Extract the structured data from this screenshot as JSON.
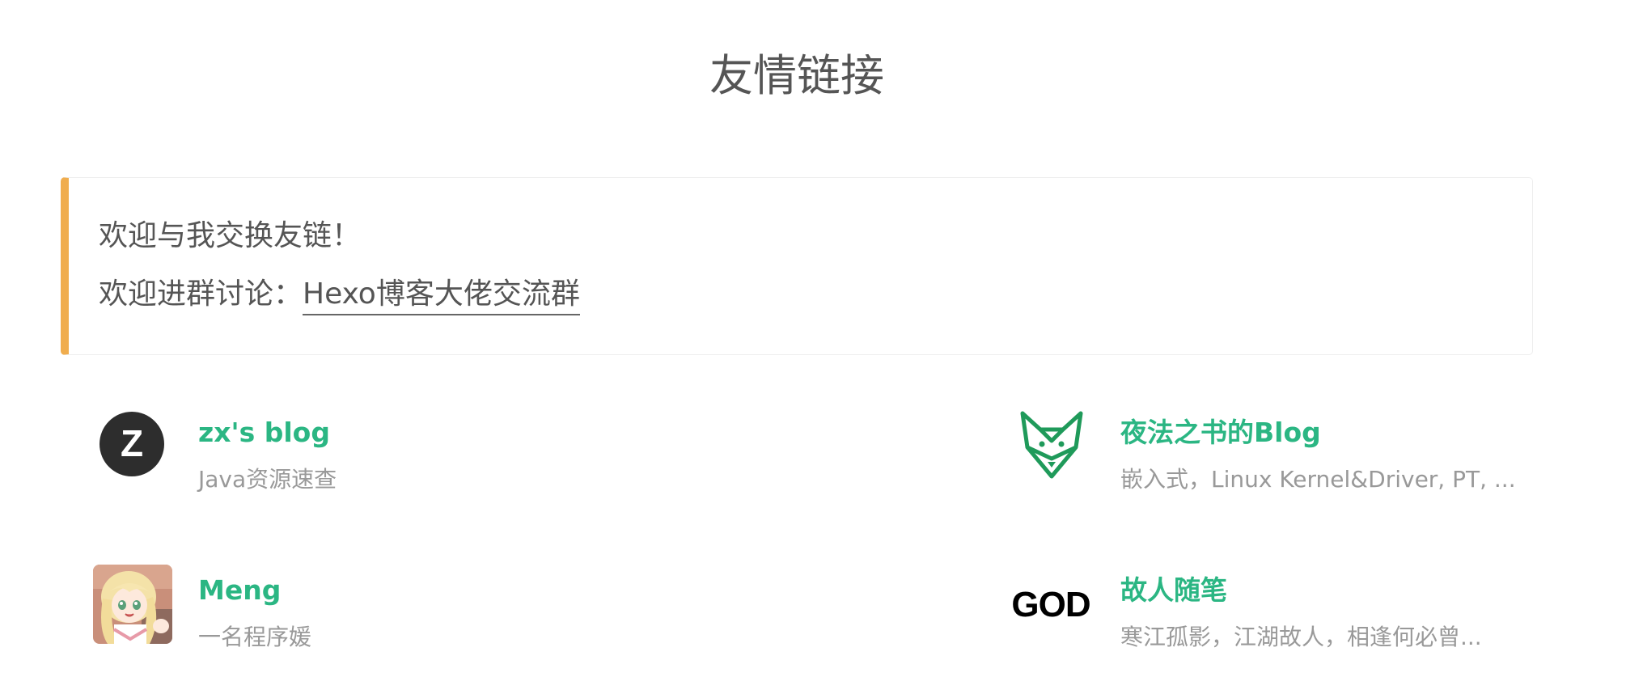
{
  "page": {
    "title": "友情链接"
  },
  "note": {
    "line1": "欢迎与我交换友链！",
    "line2_prefix": "欢迎进群讨论：",
    "line2_link": "Hexo博客大佬交流群",
    "accent_color": "#f0ad4e"
  },
  "friends": [
    {
      "name": "zx's blog",
      "description": "Java资源速查",
      "avatar_icon": "z-letter-logo-icon",
      "avatar_letter": "Z"
    },
    {
      "name": "夜法之书的Blog",
      "description": "嵌入式，Linux Kernel&Driver, PT, ...",
      "avatar_icon": "fox-head-logo-icon"
    },
    {
      "name": "Meng",
      "description": "一名程序媛",
      "avatar_icon": "anime-girl-avatar-icon"
    },
    {
      "name": "故人随笔",
      "description": "寒江孤影，江湖故人，相逢何必曾...",
      "avatar_icon": "god-text-logo-icon",
      "avatar_text": "GOD"
    }
  ],
  "colors": {
    "link_green": "#2bb683",
    "desc_gray": "#999999",
    "text": "#555555"
  }
}
